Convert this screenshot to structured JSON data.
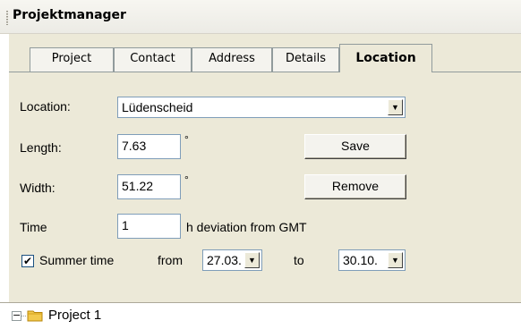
{
  "panel": {
    "title": "Projektmanager"
  },
  "tabs": [
    {
      "label": "Project"
    },
    {
      "label": "Contact"
    },
    {
      "label": "Address"
    },
    {
      "label": "Details"
    },
    {
      "label": "Location"
    }
  ],
  "active_tab": "Location",
  "location": {
    "label": "Location:",
    "value": "Lüdenscheid"
  },
  "length": {
    "label": "Length:",
    "value": "7.63",
    "unit": "°"
  },
  "width": {
    "label": "Width:",
    "value": "51.22",
    "unit": "°"
  },
  "time": {
    "label": "Time",
    "value": "1",
    "suffix": "h deviation from GMT"
  },
  "summer": {
    "checked": true,
    "label": "Summer time",
    "from_label": "from",
    "from_value": "27.03.",
    "to_label": "to",
    "to_value": "30.10."
  },
  "buttons": {
    "save": "Save",
    "remove": "Remove"
  },
  "tree": {
    "items": [
      {
        "label": "Project 1",
        "expanded": true
      }
    ]
  },
  "icons": {
    "dropdown": "chevron-down-icon",
    "folder": "folder-icon",
    "grip": "grip-icon"
  },
  "colors": {
    "dialog_bg": "#ece9d8",
    "input_border": "#7f9db9",
    "folder": "#f2c94c"
  }
}
